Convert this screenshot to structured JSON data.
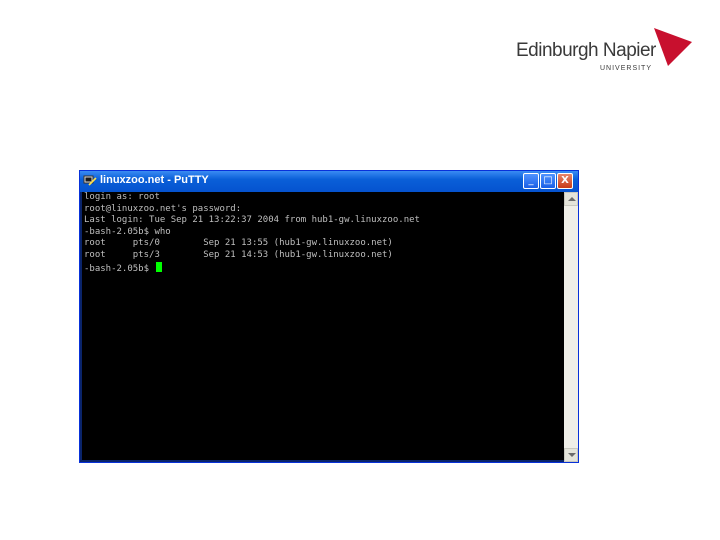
{
  "branding": {
    "name": "Edinburgh Napier",
    "sub": "UNIVERSITY",
    "accent_color": "#c8102e"
  },
  "window": {
    "title": "linuxzoo.net - PuTTY",
    "app_icon": "putty-icon",
    "controls": {
      "minimize": "_",
      "maximize": "□",
      "close": "X"
    }
  },
  "terminal": {
    "lines": [
      "login as: root",
      "root@linuxzoo.net's password:",
      "Last login: Tue Sep 21 13:22:37 2004 from hub1-gw.linuxzoo.net",
      "-bash-2.05b$ who",
      "root     pts/0        Sep 21 13:55 (hub1-gw.linuxzoo.net)",
      "root     pts/3        Sep 21 14:53 (hub1-gw.linuxzoo.net)",
      "-bash-2.05b$ "
    ],
    "cursor_color": "#00ff00"
  }
}
